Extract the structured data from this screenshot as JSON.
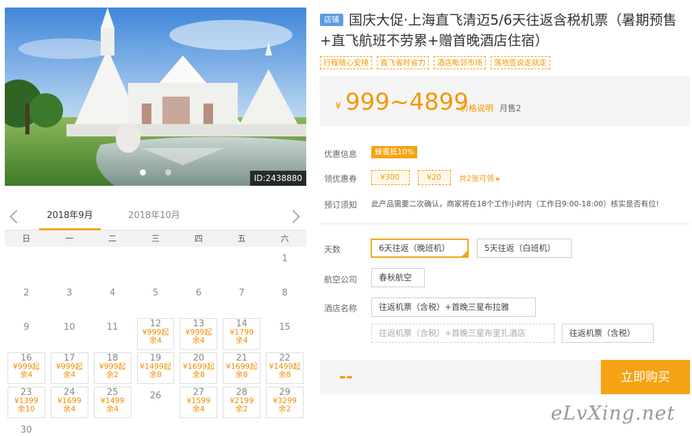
{
  "hero": {
    "image_id": "ID:2438880"
  },
  "calendar": {
    "months": [
      "2018年9月",
      "2018年10月"
    ],
    "weekdays": [
      "日",
      "一",
      "二",
      "三",
      "四",
      "五",
      "六"
    ],
    "rows": [
      [
        {
          "day": ""
        },
        {
          "day": ""
        },
        {
          "day": ""
        },
        {
          "day": ""
        },
        {
          "day": ""
        },
        {
          "day": ""
        },
        {
          "day": "1"
        }
      ],
      [
        {
          "day": "2"
        },
        {
          "day": "3"
        },
        {
          "day": "4"
        },
        {
          "day": "5"
        },
        {
          "day": "6"
        },
        {
          "day": "7"
        },
        {
          "day": "8"
        }
      ],
      [
        {
          "day": "9"
        },
        {
          "day": "10"
        },
        {
          "day": "11"
        },
        {
          "day": "12",
          "price": "¥999起",
          "left": "余4"
        },
        {
          "day": "13",
          "price": "¥999起",
          "left": "余4"
        },
        {
          "day": "14",
          "price": "¥1799",
          "left": "余4"
        },
        {
          "day": "15"
        }
      ],
      [
        {
          "day": "16",
          "price": "¥999起",
          "left": "余4"
        },
        {
          "day": "17",
          "price": "¥999起",
          "left": "余4"
        },
        {
          "day": "18",
          "price": "¥999起",
          "left": "余2"
        },
        {
          "day": "19",
          "price": "¥1499起",
          "left": "余8"
        },
        {
          "day": "20",
          "price": "¥1699起",
          "left": "余8"
        },
        {
          "day": "21",
          "price": "¥1699起",
          "left": "余8"
        },
        {
          "day": "22",
          "price": "¥1499起",
          "left": "余8"
        }
      ],
      [
        {
          "day": "23",
          "price": "¥1399",
          "left": "余10"
        },
        {
          "day": "24",
          "price": "¥1699",
          "left": "余4"
        },
        {
          "day": "25",
          "price": "¥1499",
          "left": "余4"
        },
        {
          "day": "26"
        },
        {
          "day": "27",
          "price": "¥1599",
          "left": "余4"
        },
        {
          "day": "28",
          "price": "¥2199",
          "left": "余2"
        },
        {
          "day": "29",
          "price": "¥3299",
          "left": "余2"
        }
      ],
      [
        {
          "day": "30"
        },
        {
          "day": ""
        },
        {
          "day": ""
        },
        {
          "day": ""
        },
        {
          "day": ""
        },
        {
          "day": ""
        },
        {
          "day": ""
        }
      ]
    ]
  },
  "product": {
    "badge": "店铺",
    "title": "国庆大促·上海直飞清迈5/6天往返含税机票（暑期预售+直飞航班不劳累+赠首晚酒店住宿）",
    "tags": [
      "行程随心安排",
      "直飞省时省力",
      "酒店毗邻市场",
      "落地签说走就走"
    ],
    "price_yen": "¥",
    "price_range": "999~4899",
    "price_explain": "价格说明",
    "monthly_sales": "月售2",
    "promo_label": "优惠信息",
    "promo_badge": "蜂蜜抵10%",
    "coupon_label": "领优惠券",
    "coupons": [
      "¥300",
      "¥20"
    ],
    "coupon_more": "共2张可领 ▸",
    "notice_label": "预订须知",
    "notice_text": "此产品需要二次确认，商家将在18个工作小时内（工作日9:00-18:00）核实是否有位!",
    "days_label": "天数",
    "days_options": [
      "6天往返（晚班机）",
      "5天往返（白班机）"
    ],
    "airline_label": "航空公司",
    "airline_options": [
      "春秋航空"
    ],
    "hotel_label": "酒店名称",
    "hotel_options": [
      "往返机票（含税）+首晚三星布拉雅",
      "往返机票（含税）+首晚三星布里扎酒店",
      "往返机票（含税）"
    ],
    "quantity": "--",
    "buy_label": "立即购买"
  },
  "watermark": "eLvXing.net",
  "colors": {
    "accent": "#f5a314",
    "accent_text": "#f39800",
    "shop_badge": "#5b9be0"
  }
}
